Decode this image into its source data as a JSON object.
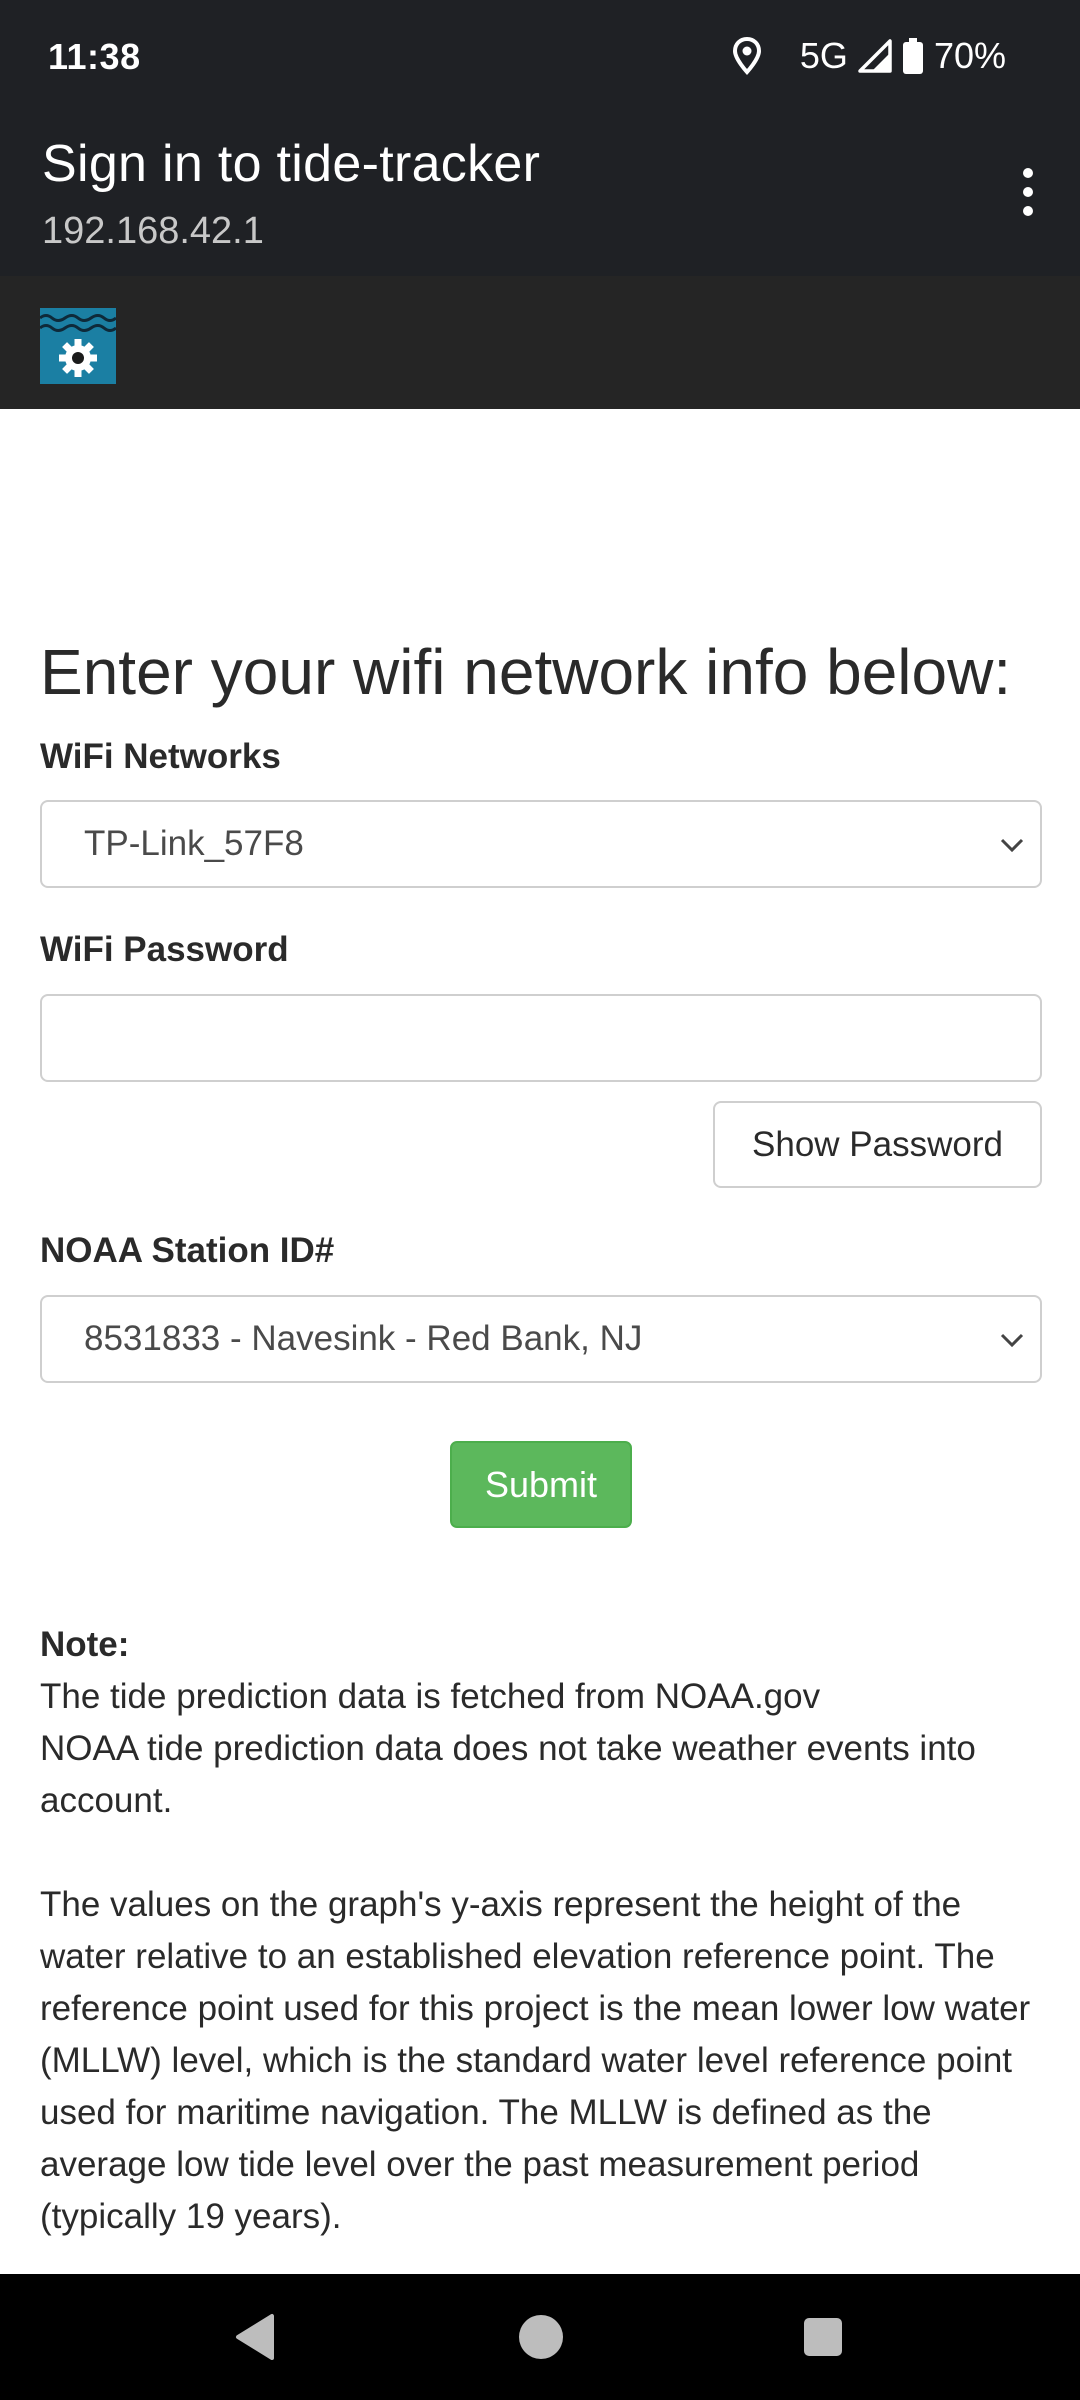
{
  "status_bar": {
    "time": "11:38",
    "network": "5G",
    "battery": "70%",
    "icons": [
      "location-icon",
      "signal-icon",
      "battery-icon"
    ]
  },
  "title_bar": {
    "title": "Sign in to tide-tracker",
    "url": "192.168.42.1",
    "menu_icon": "overflow-menu-icon"
  },
  "site_header": {
    "logo_icon": "tide-gear-logo-icon"
  },
  "form": {
    "heading": "Enter your wifi network info below:",
    "wifi_label": "WiFi Networks",
    "wifi_selected": "TP-Link_57F8",
    "password_label": "WiFi Password",
    "password_value": "",
    "show_password_label": "Show Password",
    "station_label": "NOAA Station ID#",
    "station_selected": "8531833 - Navesink - Red Bank, NJ",
    "submit_label": "Submit"
  },
  "note": {
    "title": "Note:",
    "line1": "The tide prediction data is fetched from NOAA.gov",
    "line2": "NOAA tide prediction data does not take weather events into account.",
    "paragraph": "The values on the graph's y-axis represent the height of the water relative to an established elevation reference point. The reference point used for this project is the mean lower low water (MLLW) level, which is the standard water level reference point used for maritime navigation. The MLLW is defined as the average low tide level over the past measurement period (typically 19 years)."
  },
  "colors": {
    "toolbar": "#1f2125",
    "header": "#252525",
    "submit": "#5cb85c",
    "logo_water": "#1b7fa3"
  }
}
